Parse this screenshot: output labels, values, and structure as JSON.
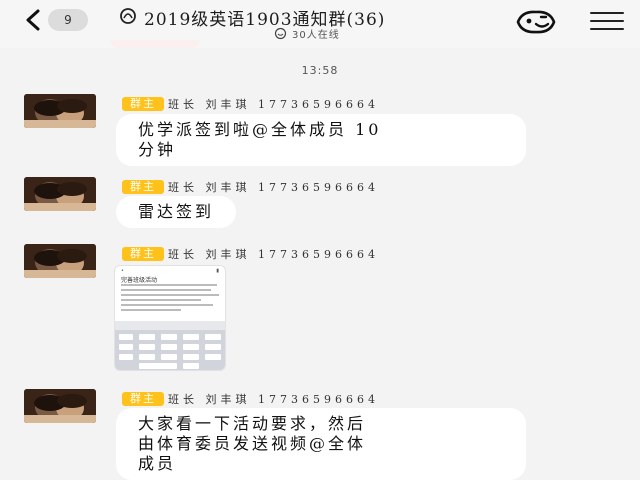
{
  "header": {
    "back_count": "9",
    "title": "2019级英语1903通知群(36)",
    "online": "30人在线"
  },
  "timestamp": "13:58",
  "messages": [
    {
      "badge": "群主",
      "sender": "班长 刘丰琪 17736596664",
      "text_line1": "优学派签到啦@全体成员 10",
      "text_line2": "分钟"
    },
    {
      "badge": "群主",
      "sender": "班长 刘丰琪 17736596664",
      "text_line1": "雷达签到"
    },
    {
      "badge": "群主",
      "sender": "班长 刘丰琪 17736596664",
      "image_heading": "完善班级活动"
    },
    {
      "badge": "群主",
      "sender": "班长 刘丰琪 17736596664",
      "text_line1": "大家看一下活动要求，然后",
      "text_line2": "由体育委员发送视频@全体",
      "text_line3": "成员"
    }
  ],
  "colors": {
    "background": "#f3f3f3",
    "bubble": "#ffffff",
    "owner_badge": "#ffc21a",
    "unread_badge": "#dcdcdc"
  },
  "icons": {
    "back": "chevron-left-icon",
    "title": "do-not-disturb-icon",
    "online": "online-status-icon",
    "cheer": "group-cheer-icon",
    "menu": "hamburger-menu-icon"
  }
}
